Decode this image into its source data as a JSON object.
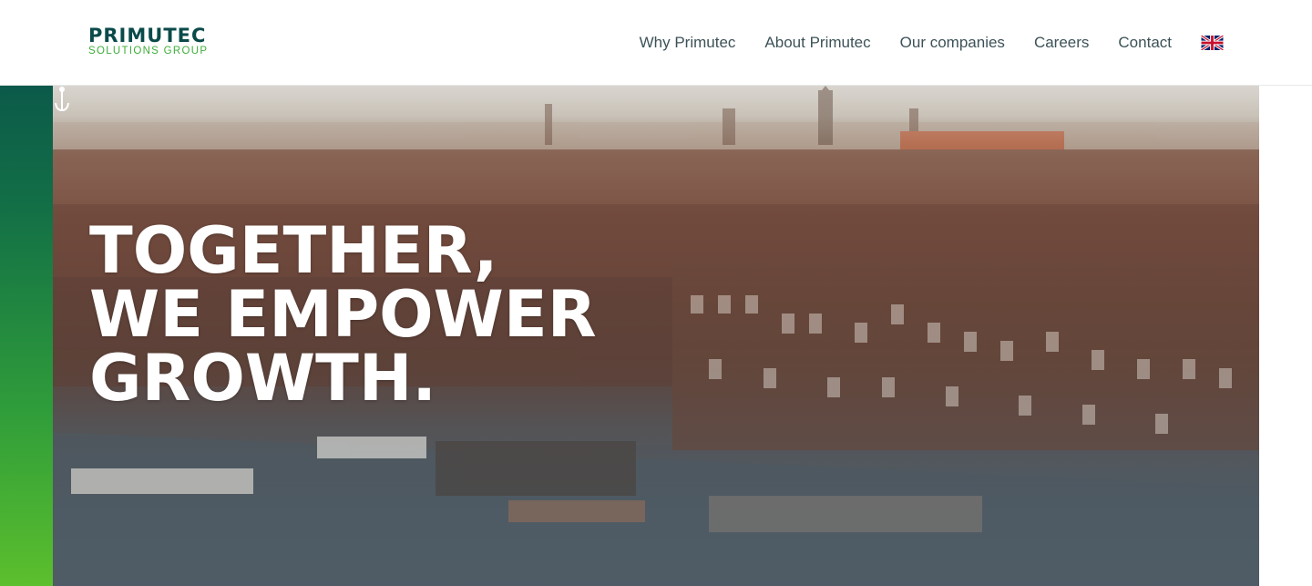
{
  "header": {
    "logo": {
      "main": "PRIMUTEC",
      "sub": "SOLUTIONS GROUP"
    },
    "nav": [
      {
        "label": "Why Primutec"
      },
      {
        "label": "About Primutec"
      },
      {
        "label": "Our companies"
      },
      {
        "label": "Careers"
      },
      {
        "label": "Contact"
      }
    ],
    "language_icon": "uk-flag-icon"
  },
  "hero": {
    "title_lines": [
      "TOGETHER,",
      "WE EMPOWER",
      "GROWTH."
    ],
    "scroll_icon": "anchor-icon"
  },
  "colors": {
    "brand_dark_green": "#0b4a4a",
    "brand_light_green": "#3fae3a",
    "nav_text": "#3d5258",
    "sidebar_gradient": [
      "#0c5a4a",
      "#5cbf2d"
    ]
  }
}
